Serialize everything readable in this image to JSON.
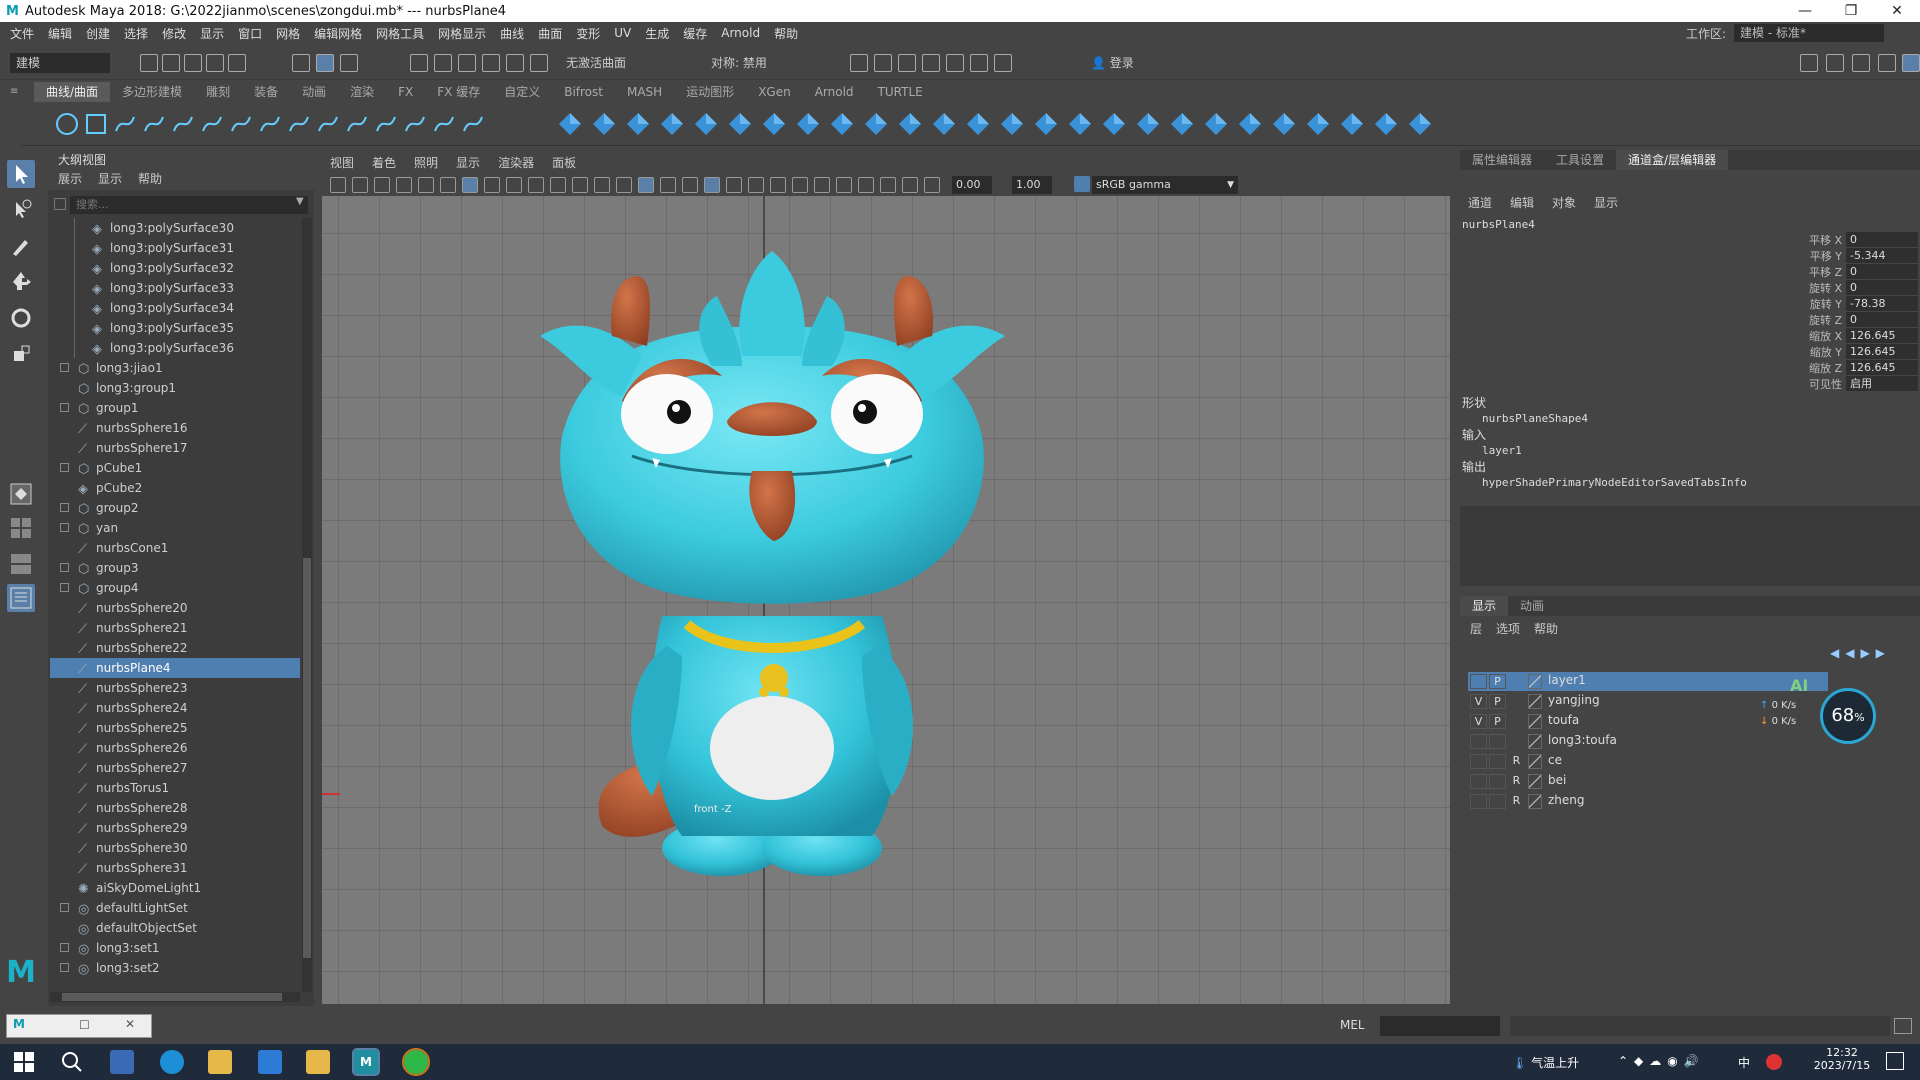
{
  "window": {
    "title": "Autodesk Maya 2018: G:\\2022jianmo\\scenes\\zongdui.mb*   ---   nurbsPlane4",
    "min": "—",
    "max": "❐",
    "close": "✕"
  },
  "menubar": [
    "文件",
    "编辑",
    "创建",
    "选择",
    "修改",
    "显示",
    "窗口",
    "网格",
    "编辑网格",
    "网格工具",
    "网格显示",
    "曲线",
    "曲面",
    "变形",
    "UV",
    "生成",
    "缓存",
    "Arnold",
    "帮助"
  ],
  "workspace": {
    "label": "工作区:",
    "value": "建模 - 标准*"
  },
  "statusline": {
    "mode": "建模",
    "live_surface": "无激活曲面",
    "symmetry": "对称: 禁用",
    "login": "登录"
  },
  "shelf": {
    "tabs": [
      "曲线/曲面",
      "多边形建模",
      "雕刻",
      "装备",
      "动画",
      "渲染",
      "FX",
      "FX 缓存",
      "自定义",
      "Bifrost",
      "MASH",
      "运动图形",
      "XGen",
      "Arnold",
      "TURTLE"
    ],
    "active": 0
  },
  "outliner": {
    "title": "大纲视图",
    "menu": [
      "展示",
      "显示",
      "帮助"
    ],
    "search_placeholder": "搜索...",
    "items": [
      {
        "label": "long3:polySurface30",
        "indent": 2,
        "icon": "mesh",
        "expand": ""
      },
      {
        "label": "long3:polySurface31",
        "indent": 2,
        "icon": "mesh",
        "expand": ""
      },
      {
        "label": "long3:polySurface32",
        "indent": 2,
        "icon": "mesh",
        "expand": ""
      },
      {
        "label": "long3:polySurface33",
        "indent": 2,
        "icon": "mesh",
        "expand": ""
      },
      {
        "label": "long3:polySurface34",
        "indent": 2,
        "icon": "mesh",
        "expand": ""
      },
      {
        "label": "long3:polySurface35",
        "indent": 2,
        "icon": "mesh",
        "expand": ""
      },
      {
        "label": "long3:polySurface36",
        "indent": 2,
        "icon": "mesh",
        "expand": ""
      },
      {
        "label": "long3:jiao1",
        "indent": 1,
        "icon": "group",
        "expand": "+"
      },
      {
        "label": "long3:group1",
        "indent": 1,
        "icon": "group",
        "expand": ""
      },
      {
        "label": "group1",
        "indent": 1,
        "icon": "group",
        "expand": "+"
      },
      {
        "label": "nurbsSphere16",
        "indent": 1,
        "icon": "nurbs",
        "expand": ""
      },
      {
        "label": "nurbsSphere17",
        "indent": 1,
        "icon": "nurbs",
        "expand": ""
      },
      {
        "label": "pCube1",
        "indent": 1,
        "icon": "group",
        "expand": "+"
      },
      {
        "label": "pCube2",
        "indent": 1,
        "icon": "mesh",
        "expand": ""
      },
      {
        "label": "group2",
        "indent": 1,
        "icon": "group",
        "expand": "+"
      },
      {
        "label": "yan",
        "indent": 1,
        "icon": "group",
        "expand": "+"
      },
      {
        "label": "nurbsCone1",
        "indent": 1,
        "icon": "nurbs",
        "expand": ""
      },
      {
        "label": "group3",
        "indent": 1,
        "icon": "group",
        "expand": "+"
      },
      {
        "label": "group4",
        "indent": 1,
        "icon": "group",
        "expand": "+"
      },
      {
        "label": "nurbsSphere20",
        "indent": 1,
        "icon": "nurbs",
        "expand": ""
      },
      {
        "label": "nurbsSphere21",
        "indent": 1,
        "icon": "nurbs",
        "expand": ""
      },
      {
        "label": "nurbsSphere22",
        "indent": 1,
        "icon": "nurbs",
        "expand": ""
      },
      {
        "label": "nurbsPlane4",
        "indent": 1,
        "icon": "nurbs",
        "expand": "",
        "selected": true
      },
      {
        "label": "nurbsSphere23",
        "indent": 1,
        "icon": "nurbs",
        "expand": ""
      },
      {
        "label": "nurbsSphere24",
        "indent": 1,
        "icon": "nurbs",
        "expand": ""
      },
      {
        "label": "nurbsSphere25",
        "indent": 1,
        "icon": "nurbs",
        "expand": ""
      },
      {
        "label": "nurbsSphere26",
        "indent": 1,
        "icon": "nurbs",
        "expand": ""
      },
      {
        "label": "nurbsSphere27",
        "indent": 1,
        "icon": "nurbs",
        "expand": ""
      },
      {
        "label": "nurbsTorus1",
        "indent": 1,
        "icon": "nurbs",
        "expand": ""
      },
      {
        "label": "nurbsSphere28",
        "indent": 1,
        "icon": "nurbs",
        "expand": ""
      },
      {
        "label": "nurbsSphere29",
        "indent": 1,
        "icon": "nurbs",
        "expand": ""
      },
      {
        "label": "nurbsSphere30",
        "indent": 1,
        "icon": "nurbs",
        "expand": ""
      },
      {
        "label": "nurbsSphere31",
        "indent": 1,
        "icon": "nurbs",
        "expand": ""
      },
      {
        "label": "aiSkyDomeLight1",
        "indent": 1,
        "icon": "light",
        "expand": ""
      },
      {
        "label": "defaultLightSet",
        "indent": 1,
        "icon": "set",
        "expand": "+"
      },
      {
        "label": "defaultObjectSet",
        "indent": 1,
        "icon": "set",
        "expand": ""
      },
      {
        "label": "long3:set1",
        "indent": 1,
        "icon": "set",
        "expand": "+"
      },
      {
        "label": "long3:set2",
        "indent": 1,
        "icon": "set",
        "expand": "+"
      }
    ]
  },
  "viewport": {
    "menu": [
      "视图",
      "着色",
      "照明",
      "显示",
      "渲染器",
      "面板"
    ],
    "exposure": "0.00",
    "gamma": "1.00",
    "colorspace": "sRGB gamma",
    "camera_label": "front -Z"
  },
  "right_tabs": [
    "属性编辑器",
    "工具设置",
    "通道盒/层编辑器"
  ],
  "right_tab_active": 2,
  "channelbox": {
    "menu": [
      "通道",
      "编辑",
      "对象",
      "显示"
    ],
    "object": "nurbsPlane4",
    "attrs": [
      {
        "name": "平移 X",
        "value": "0"
      },
      {
        "name": "平移 Y",
        "value": "-5.344"
      },
      {
        "name": "平移 Z",
        "value": "0"
      },
      {
        "name": "旋转 X",
        "value": "0"
      },
      {
        "name": "旋转 Y",
        "value": "-78.38"
      },
      {
        "name": "旋转 Z",
        "value": "0"
      },
      {
        "name": "缩放 X",
        "value": "126.645"
      },
      {
        "name": "缩放 Y",
        "value": "126.645"
      },
      {
        "name": "缩放 Z",
        "value": "126.645"
      },
      {
        "name": "可见性",
        "value": "启用"
      }
    ],
    "shapes_label": "形状",
    "shape": "nurbsPlaneShape4",
    "inputs_label": "输入",
    "input": "layer1",
    "outputs_label": "输出",
    "output": "hyperShadePrimaryNodeEditorSavedTabsInfo"
  },
  "layer_editor": {
    "tabs": [
      "显示",
      "动画"
    ],
    "menu": [
      "层",
      "选项",
      "帮助"
    ],
    "layers": [
      {
        "v": "",
        "p": "P",
        "r": "",
        "name": "layer1",
        "selected": true
      },
      {
        "v": "V",
        "p": "P",
        "r": "",
        "name": "yangjing"
      },
      {
        "v": "V",
        "p": "P",
        "r": "",
        "name": "toufa"
      },
      {
        "v": "",
        "p": "",
        "r": "",
        "name": "long3:toufa"
      },
      {
        "v": "",
        "p": "",
        "r": "R",
        "name": "ce"
      },
      {
        "v": "",
        "p": "",
        "r": "R",
        "name": "bei"
      },
      {
        "v": "",
        "p": "",
        "r": "R",
        "name": "zheng"
      }
    ],
    "net_up": "0 K/s",
    "net_down": "0 K/s",
    "cpu": "68",
    "cpu_unit": "%",
    "ai_badge": "AI"
  },
  "cmdline": {
    "lang": "MEL"
  },
  "taskbar": {
    "weather": "气温上升",
    "ime": "中",
    "time": "12:32",
    "date": "2023/7/15"
  },
  "colors": {
    "cyan_character": "#3cc7dc",
    "accent_select": "#4f7fb0",
    "horns": "#b45a35"
  }
}
